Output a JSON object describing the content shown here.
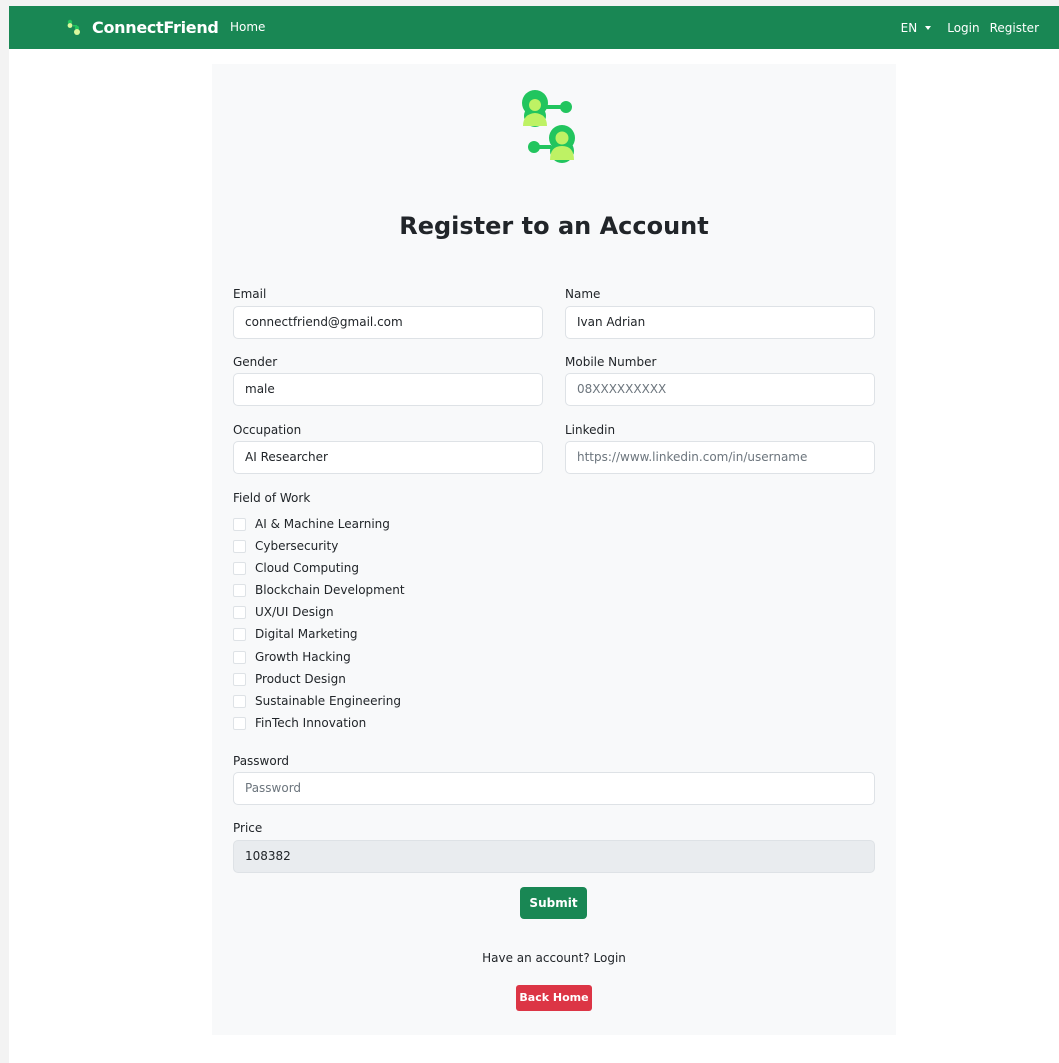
{
  "nav": {
    "brand": "ConnectFriend",
    "home": "Home",
    "language": "EN",
    "login": "Login",
    "register": "Register",
    "bg_color": "#198754"
  },
  "form": {
    "title": "Register to an Account",
    "email_label": "Email",
    "email_value": "connectfriend@gmail.com",
    "name_label": "Name",
    "name_value": "Ivan Adrian",
    "gender_label": "Gender",
    "gender_value": "male",
    "mobile_label": "Mobile Number",
    "mobile_value": "08XXXXXXXXX",
    "occupation_label": "Occupation",
    "occupation_value": "AI Researcher",
    "linkedin_label": "Linkedin",
    "linkedin_value": "https://www.linkedin.com/in/username",
    "field_label": "Field of Work",
    "fields": [
      "AI & Machine Learning",
      "Cybersecurity",
      "Cloud Computing",
      "Blockchain Development",
      "UX/UI Design",
      "Digital Marketing",
      "Growth Hacking",
      "Product Design",
      "Sustainable Engineering",
      "FinTech Innovation"
    ],
    "password_label": "Password",
    "password_placeholder": "Password",
    "price_label": "Price",
    "price_value": "108382",
    "submit": "Submit",
    "have_account": "Have an account? Login",
    "back_home": "Back Home"
  },
  "icons": {
    "brand": "people-connect-icon",
    "logo": "people-network-logo"
  },
  "colors": {
    "primary": "#198754",
    "danger": "#dc3545",
    "logo_green": "#22c55e",
    "logo_light": "#bef264"
  }
}
